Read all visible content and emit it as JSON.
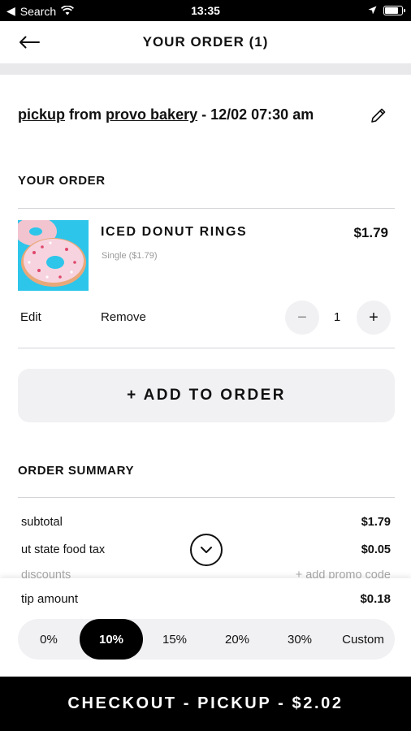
{
  "status_bar": {
    "carrier": "Search",
    "time": "13:35"
  },
  "header": {
    "title": "YOUR ORDER (1)"
  },
  "pickup": {
    "mode": "pickup",
    "from_word": "from",
    "store": "provo bakery",
    "datetime": "- 12/02 07:30 am"
  },
  "order": {
    "section_title": "YOUR ORDER",
    "item": {
      "name": "ICED DONUT RINGS",
      "price": "$1.79",
      "variant": "Single ($1.79)",
      "edit_label": "Edit",
      "remove_label": "Remove",
      "quantity": "1",
      "minus": "−",
      "plus": "+"
    },
    "add_button": "+ ADD TO ORDER"
  },
  "summary": {
    "section_title": "ORDER SUMMARY",
    "rows": [
      {
        "label": "subtotal",
        "value": "$1.79"
      },
      {
        "label": "ut state food tax",
        "value": "$0.05"
      }
    ],
    "partial_row": {
      "label": "discounts",
      "value": "+ add promo code"
    }
  },
  "tip": {
    "label": "tip amount",
    "value": "$0.18",
    "options": [
      "0%",
      "10%",
      "15%",
      "20%",
      "30%",
      "Custom"
    ],
    "selected": "10%"
  },
  "checkout": {
    "label": "CHECKOUT - PICKUP - $2.02"
  },
  "icons": {
    "back": "arrow-left-icon",
    "edit": "pencil-icon",
    "expand": "chevron-down-icon",
    "wifi": "wifi-icon",
    "location": "location-arrow-icon",
    "battery": "battery-icon"
  },
  "colors": {
    "accent": "#000000",
    "panel": "#f1f1f4",
    "image_bg": "#2ec5ea",
    "muted_text": "#9a9a9a"
  }
}
